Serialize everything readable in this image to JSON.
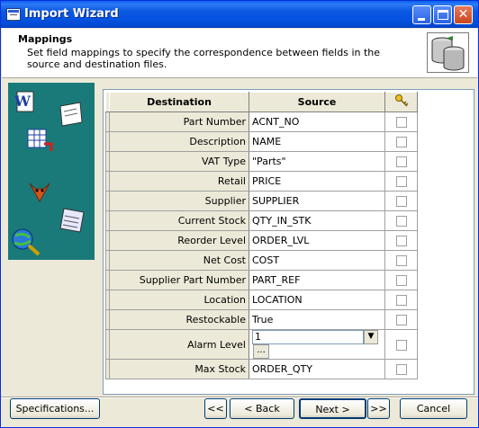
{
  "window": {
    "title": "Import Wizard"
  },
  "header": {
    "title": "Mappings",
    "subtitle": "Set field mappings to specify the correspondence between fields in the source and destination files."
  },
  "grid": {
    "columns": {
      "destination": "Destination",
      "source": "Source",
      "key_icon": "key-icon"
    },
    "rows": [
      {
        "destination": "Part Number",
        "source": "ACNT_NO",
        "key": false
      },
      {
        "destination": "Description",
        "source": "NAME",
        "key": false
      },
      {
        "destination": "VAT Type",
        "source": "\"Parts\"",
        "key": false
      },
      {
        "destination": "Retail",
        "source": "PRICE",
        "key": false
      },
      {
        "destination": "Supplier",
        "source": "SUPPLIER",
        "key": false
      },
      {
        "destination": "Current Stock",
        "source": "QTY_IN_STK",
        "key": false
      },
      {
        "destination": "Reorder Level",
        "source": "ORDER_LVL",
        "key": false
      },
      {
        "destination": "Net Cost",
        "source": "COST",
        "key": false
      },
      {
        "destination": "Supplier Part Number",
        "source": "PART_REF",
        "key": false
      },
      {
        "destination": "Location",
        "source": "LOCATION",
        "key": false
      },
      {
        "destination": "Restockable",
        "source": "True",
        "key": false
      },
      {
        "destination": "Alarm Level",
        "source": "1",
        "key": false,
        "editing": true
      },
      {
        "destination": "Max Stock",
        "source": "ORDER_QTY",
        "key": false
      }
    ],
    "ellipsis_label": "..."
  },
  "buttons": {
    "specifications": "Specifications...",
    "first": "<<",
    "back": "< Back",
    "next": "Next >",
    "last": ">>",
    "cancel": "Cancel"
  },
  "colors": {
    "titlebar": "#0553e1",
    "sidepanel": "#1a7a7a",
    "face": "#ece9d8"
  }
}
